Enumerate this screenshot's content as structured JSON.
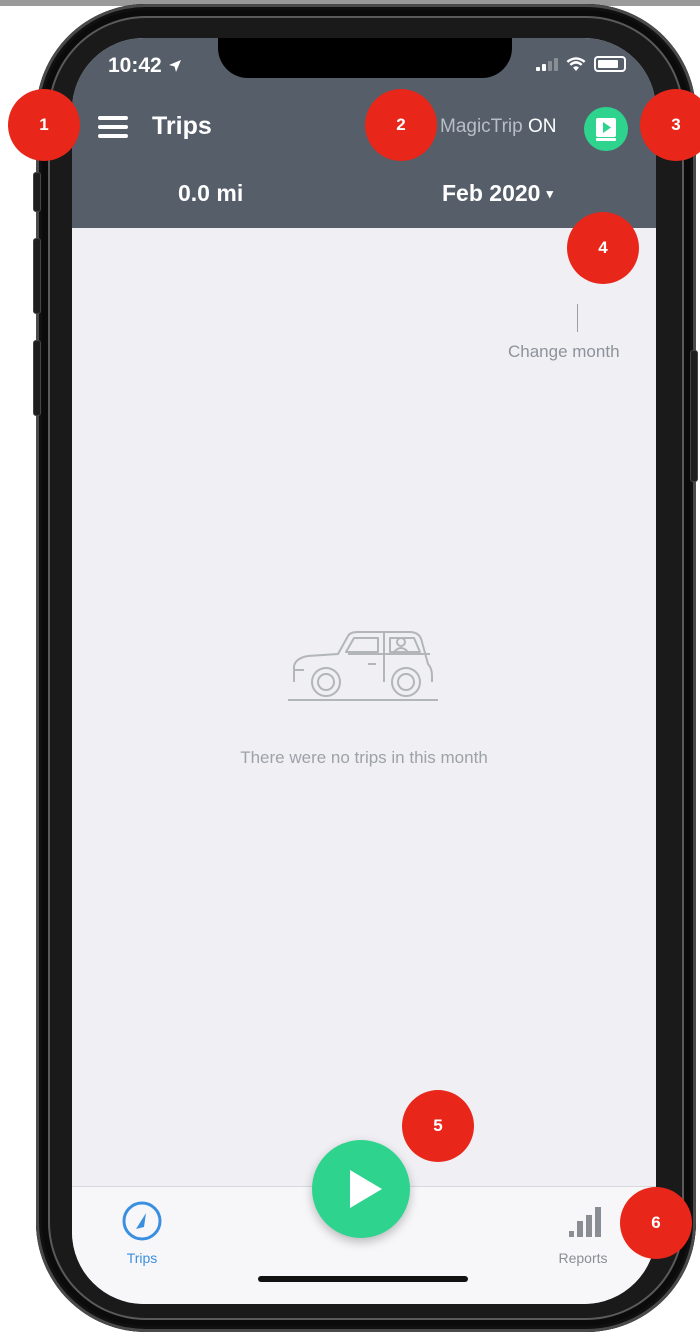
{
  "status_bar": {
    "time": "10:42"
  },
  "header": {
    "title": "Trips",
    "magictrip_label": "MagicTrip",
    "magictrip_state": "ON",
    "distance": "0.0 mi",
    "month": "Feb 2020",
    "month_caret": "▾"
  },
  "hint": {
    "change_month": "Change month"
  },
  "empty_state": {
    "message": "There were no trips in this month",
    "icon": "car-icon"
  },
  "tabbar": {
    "trips_label": "Trips",
    "reports_label": "Reports"
  },
  "callouts": [
    "1",
    "2",
    "3",
    "4",
    "5",
    "6"
  ],
  "colors": {
    "header_bg": "#555e69",
    "accent_green": "#2ed38e",
    "callout_red": "#e8271a",
    "active_tab": "#3b8fe0",
    "screen_bg": "#efeff4"
  }
}
